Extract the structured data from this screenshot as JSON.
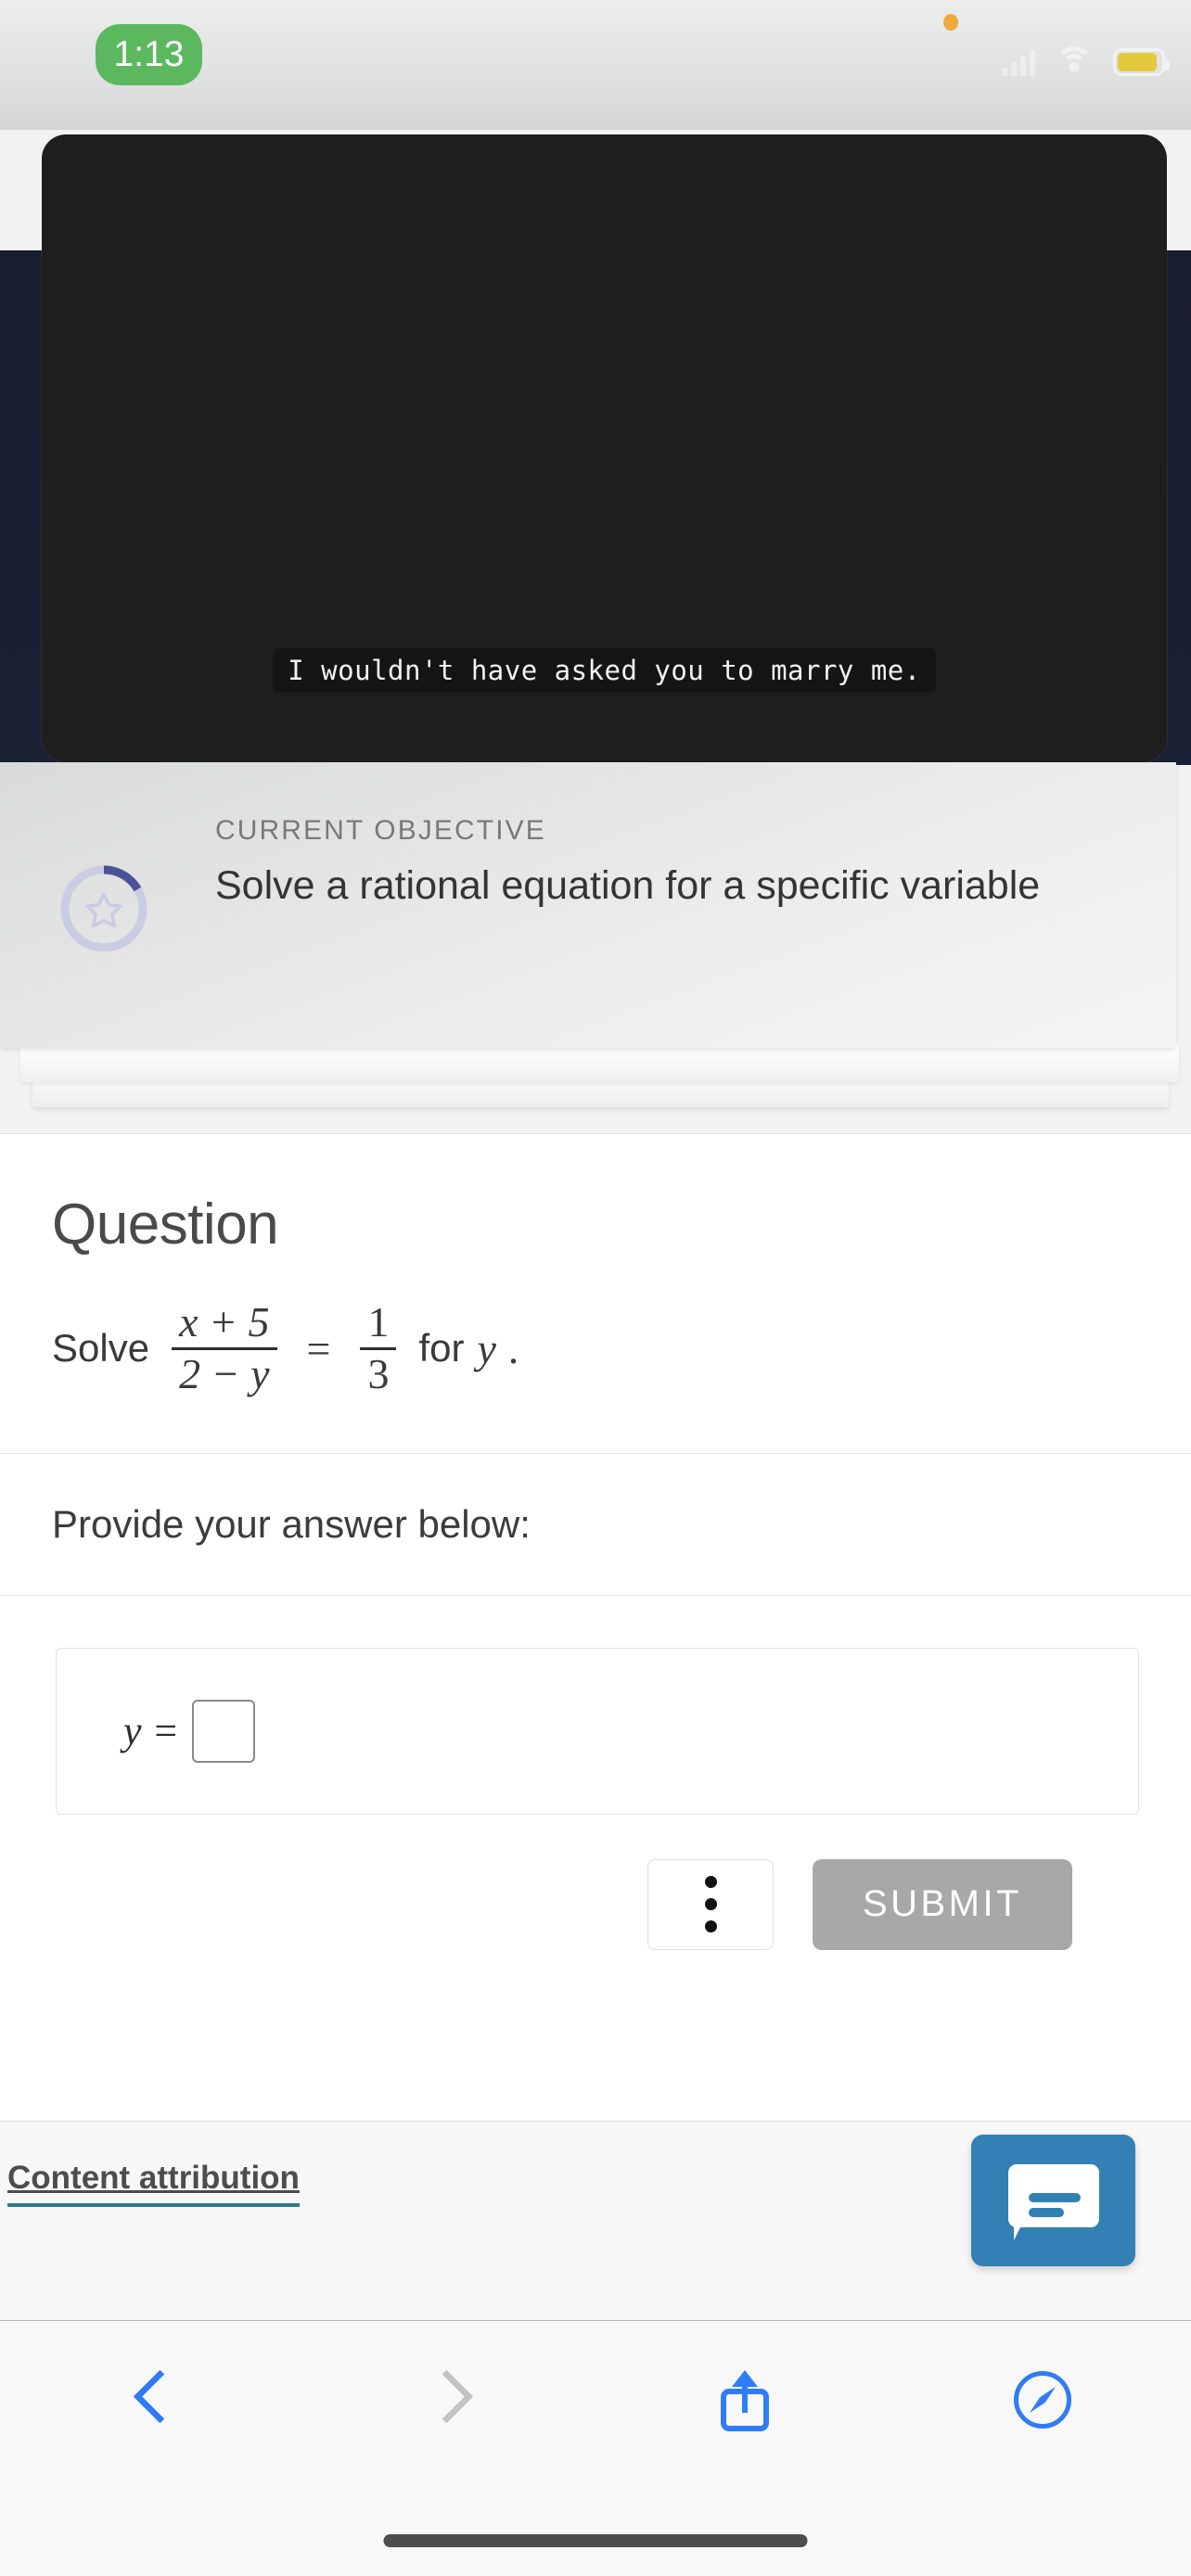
{
  "status_bar": {
    "time": "1:13",
    "time_pill_color": "#5cb85f",
    "privacy_dot_color": "#f0a93c",
    "battery_color": "#e3ca3c",
    "icons": [
      "privacy-dot",
      "cellular-signal",
      "wifi",
      "battery-low-power"
    ]
  },
  "video_player": {
    "caption": "I wouldn't have asked you to marry me.",
    "background_color": "#1e1e1e"
  },
  "objective": {
    "label": "CURRENT OBJECTIVE",
    "title": "Solve a rational equation for a specific variable",
    "ring_track_color": "#c9cce2",
    "ring_progress_color": "#4b5196",
    "icon": "star-outline-icon"
  },
  "question": {
    "heading": "Question",
    "prompt_prefix": "Solve",
    "fraction_left": {
      "numerator": "x + 5",
      "denominator": "2 − y"
    },
    "equals": "=",
    "fraction_right": {
      "numerator": "1",
      "denominator": "3"
    },
    "prompt_suffix": "for",
    "variable": "y",
    "period": "."
  },
  "answer_section": {
    "prompt": "Provide your answer below:",
    "variable_label": "y =",
    "input_value": "",
    "input_placeholder": ""
  },
  "actions": {
    "more_options_label": "",
    "more_options_icon": "kebab-menu-icon",
    "submit_label": "SUBMIT",
    "submit_enabled": false,
    "submit_color": "#a8a8a8"
  },
  "footer": {
    "attribution_label": "Content attribution",
    "attribution_underline_color": "#2b7a8c",
    "chat_button_color": "#3380b5",
    "chat_button_icon": "chat-bubble-icon"
  },
  "browser_toolbar": {
    "back_label": "",
    "forward_label": "",
    "share_label": "",
    "tabs_label": "",
    "back_enabled": true,
    "forward_enabled": false,
    "accent_color": "#2f7cf6",
    "disabled_color": "#c3c3c3"
  }
}
